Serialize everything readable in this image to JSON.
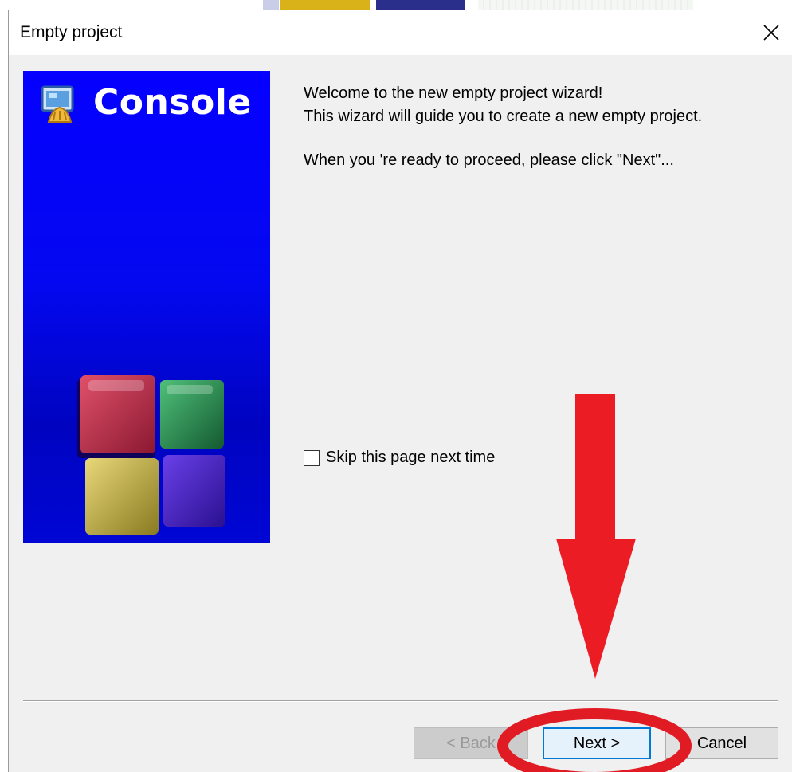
{
  "dialog": {
    "title": "Empty project",
    "close_icon": "close-icon"
  },
  "side_panel": {
    "logo_icon": "console-app-icon",
    "title": "Console",
    "background_color": "#0500ff"
  },
  "content": {
    "welcome_line1": "Welcome to the new empty project wizard!",
    "welcome_line2": "This wizard will guide you to create a new empty project.",
    "proceed_text": "When you 're ready to proceed, please click \"Next\"..."
  },
  "skip_checkbox": {
    "label": "Skip this page next time",
    "checked": false
  },
  "buttons": {
    "back": "< Back",
    "next": "Next >",
    "cancel": "Cancel"
  },
  "annotation": {
    "arrow_color": "#ec1c24",
    "arrow_icon": "down-arrow-icon",
    "circle_icon": "highlight-ellipse-icon"
  }
}
